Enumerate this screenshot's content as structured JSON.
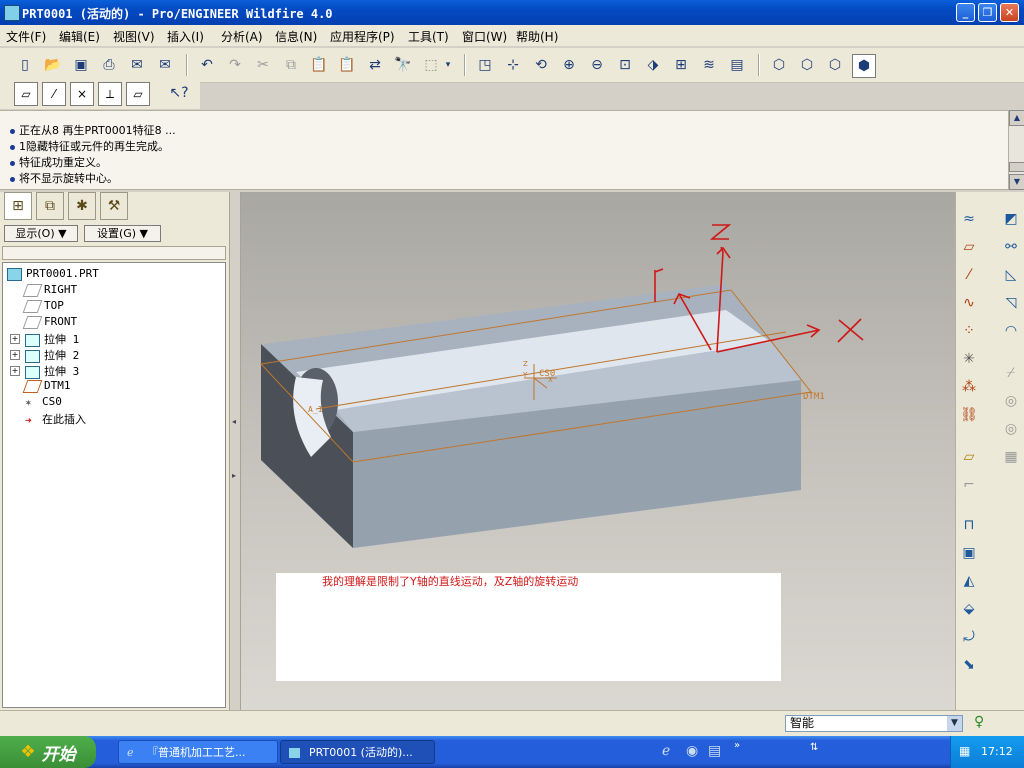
{
  "window": {
    "title": "PRT0001 (活动的) - Pro/ENGINEER Wildfire 4.0",
    "min": "_",
    "max": "❐",
    "close": "✕"
  },
  "menubar": {
    "items": [
      "文件(F)",
      "编辑(E)",
      "视图(V)",
      "插入(I)",
      "分析(A)",
      "信息(N)",
      "应用程序(P)",
      "工具(T)",
      "窗口(W)",
      "帮助(H)"
    ]
  },
  "messages": [
    "正在从8 再生PRT0001特征8 ...",
    "1隐藏特征或元件的再生完成。",
    "特征成功重定义。",
    "将不显示旋转中心。"
  ],
  "left_panel": {
    "show_button": "显示(O) ▼",
    "settings_button": "设置(G) ▼",
    "tree": [
      {
        "label": "PRT0001.PRT",
        "icon": "part-icon"
      },
      {
        "label": "RIGHT",
        "icon": "datum-plane-icon"
      },
      {
        "label": "TOP",
        "icon": "datum-plane-icon"
      },
      {
        "label": "FRONT",
        "icon": "datum-plane-icon"
      },
      {
        "label": "拉伸 1",
        "icon": "extrude-icon"
      },
      {
        "label": "拉伸 2",
        "icon": "extrude-icon"
      },
      {
        "label": "拉伸 3",
        "icon": "extrude-icon"
      },
      {
        "label": "DTM1",
        "icon": "datum-plane-icon"
      },
      {
        "label": "CS0",
        "icon": "coordinate-system-icon"
      },
      {
        "label": "在此插入",
        "icon": "insert-here-arrow-icon"
      }
    ]
  },
  "graphics": {
    "axis_z": "Z",
    "axis_x": "X",
    "axis_y": "Y",
    "csys_label": "CS0",
    "csys_y": "Y",
    "csys_z": "Z",
    "csys_x": "X",
    "datum_a1": "A_1",
    "datum_dtm1": "DTM1",
    "note": "我的理解是限制了Y轴的直线运动，及Z轴的旋转运动"
  },
  "statusbar": {
    "filter_value": "智能"
  },
  "taskbar": {
    "start": "开始",
    "task1": "『普通机加工工艺...",
    "task2": "PRT0001 (活动的)...",
    "clock": "17:12"
  },
  "colors": {
    "titlebar": "#0449c2",
    "graphics_bg": "#c3c0ba",
    "annotation_red": "#d01818",
    "datum_orange": "#c0762a",
    "model_face": "#a6b3c4"
  }
}
